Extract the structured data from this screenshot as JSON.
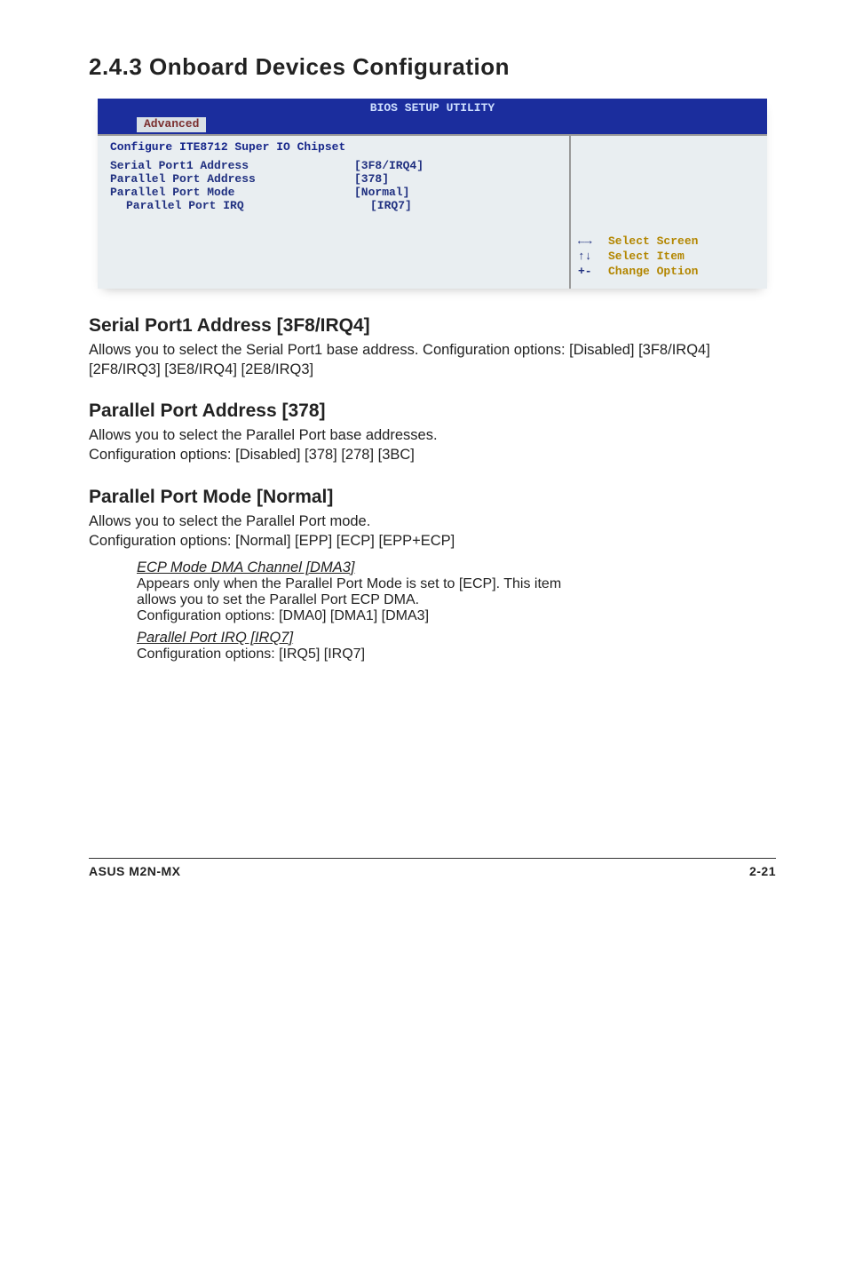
{
  "heading": "2.4.3   Onboard Devices Configuration",
  "bios": {
    "window_title": "BIOS SETUP UTILITY",
    "tab": "Advanced",
    "panel_title": "Configure ITE8712 Super IO Chipset",
    "rows": [
      {
        "label": "Serial Port1 Address",
        "value": "[3F8/IRQ4]",
        "indent": false
      },
      {
        "label": "Parallel Port Address",
        "value": "[378]",
        "indent": false
      },
      {
        "label": "Parallel Port Mode",
        "value": "[Normal]",
        "indent": false
      },
      {
        "label": "Parallel Port IRQ",
        "value": "[IRQ7]",
        "indent": true
      }
    ],
    "help": {
      "l1_key": "←→",
      "l1_txt": "Select Screen",
      "l2_key": "↑↓",
      "l2_txt": "Select Item",
      "l3_key": "+-",
      "l3_txt": "Change Option"
    }
  },
  "s1": {
    "title": "Serial Port1 Address [3F8/IRQ4]",
    "p": "Allows you to select the Serial Port1 base address. Configuration options: [Disabled] [3F8/IRQ4][2F8/IRQ3] [3E8/IRQ4] [2E8/IRQ3]"
  },
  "s2": {
    "title": "Parallel Port Address [378]",
    "p1": "Allows you to select the Parallel Port base addresses.",
    "p2": "Configuration options: [Disabled] [378] [278] [3BC]"
  },
  "s3": {
    "title": "Parallel Port Mode [Normal]",
    "p1": "Allows you to select the Parallel Port  mode.",
    "p2": "Configuration options: [Normal] [EPP] [ECP] [EPP+ECP]",
    "sub1_title": "ECP Mode DMA Channel [DMA3]",
    "sub1_l1": "Appears only when the Parallel Port Mode is set to [ECP]. This item",
    "sub1_l2": "allows you to set the Parallel Port ECP DMA.",
    "sub1_l3": "Configuration options: [DMA0] [DMA1] [DMA3]",
    "sub2_title": "Parallel Port IRQ [IRQ7]",
    "sub2_l1": "Configuration options: [IRQ5] [IRQ7]"
  },
  "footer": {
    "left": "ASUS M2N-MX",
    "right": "2-21"
  }
}
